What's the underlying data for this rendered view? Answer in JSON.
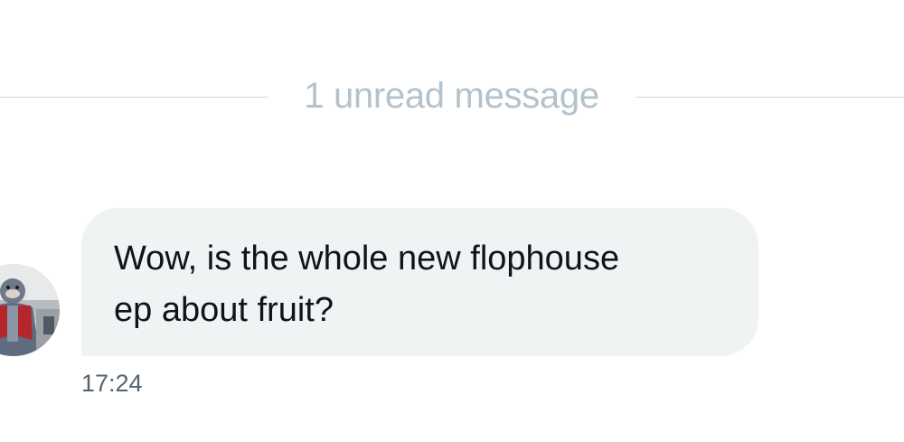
{
  "divider": {
    "text": "1 unread message"
  },
  "message": {
    "text": "Wow, is the whole new flophouse\nep about fruit?",
    "timestamp": "17:24"
  },
  "colors": {
    "bubble_bg": "#eff3f4",
    "divider_line": "#cfd9de",
    "divider_text": "#b3c2cc",
    "message_text": "#0f1419",
    "timestamp_text": "#536471"
  },
  "icons": {
    "avatar": "user-avatar-photo"
  }
}
